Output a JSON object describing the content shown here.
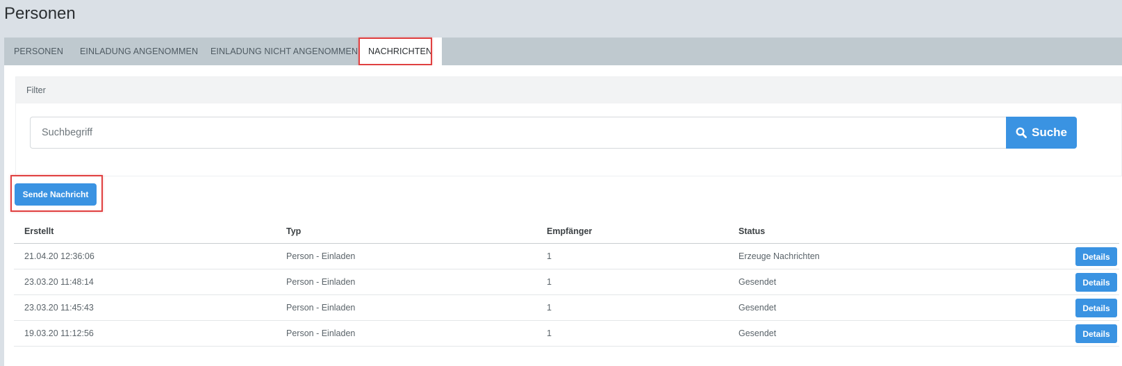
{
  "page": {
    "title": "Personen"
  },
  "tabs": [
    {
      "label": "PERSONEN"
    },
    {
      "label": "EINLADUNG ANGENOMMEN"
    },
    {
      "label": "EINLADUNG NICHT ANGENOMMEN"
    },
    {
      "label": "NACHRICHTEN",
      "active": true
    }
  ],
  "filter": {
    "header": "Filter",
    "search_placeholder": "Suchbegriff",
    "search_value": "",
    "search_button_label": "Suche",
    "search_button_icon": "search-icon"
  },
  "actions": {
    "send_message_label": "Sende Nachricht"
  },
  "table": {
    "columns": [
      "Erstellt",
      "Typ",
      "Empfänger",
      "Status"
    ],
    "rows": [
      {
        "erstellt": "21.04.20 12:36:06",
        "typ": "Person - Einladen",
        "empfaenger": "1",
        "status": "Erzeuge Nachrichten",
        "action": "Details"
      },
      {
        "erstellt": "23.03.20 11:48:14",
        "typ": "Person - Einladen",
        "empfaenger": "1",
        "status": "Gesendet",
        "action": "Details"
      },
      {
        "erstellt": "23.03.20 11:45:43",
        "typ": "Person - Einladen",
        "empfaenger": "1",
        "status": "Gesendet",
        "action": "Details"
      },
      {
        "erstellt": "19.03.20 11:12:56",
        "typ": "Person - Einladen",
        "empfaenger": "1",
        "status": "Gesendet",
        "action": "Details"
      }
    ]
  },
  "colors": {
    "accent": "#3a93e2",
    "highlight": "#e04040",
    "background": "#dae0e6",
    "tabbar": "#bfc9cf"
  }
}
